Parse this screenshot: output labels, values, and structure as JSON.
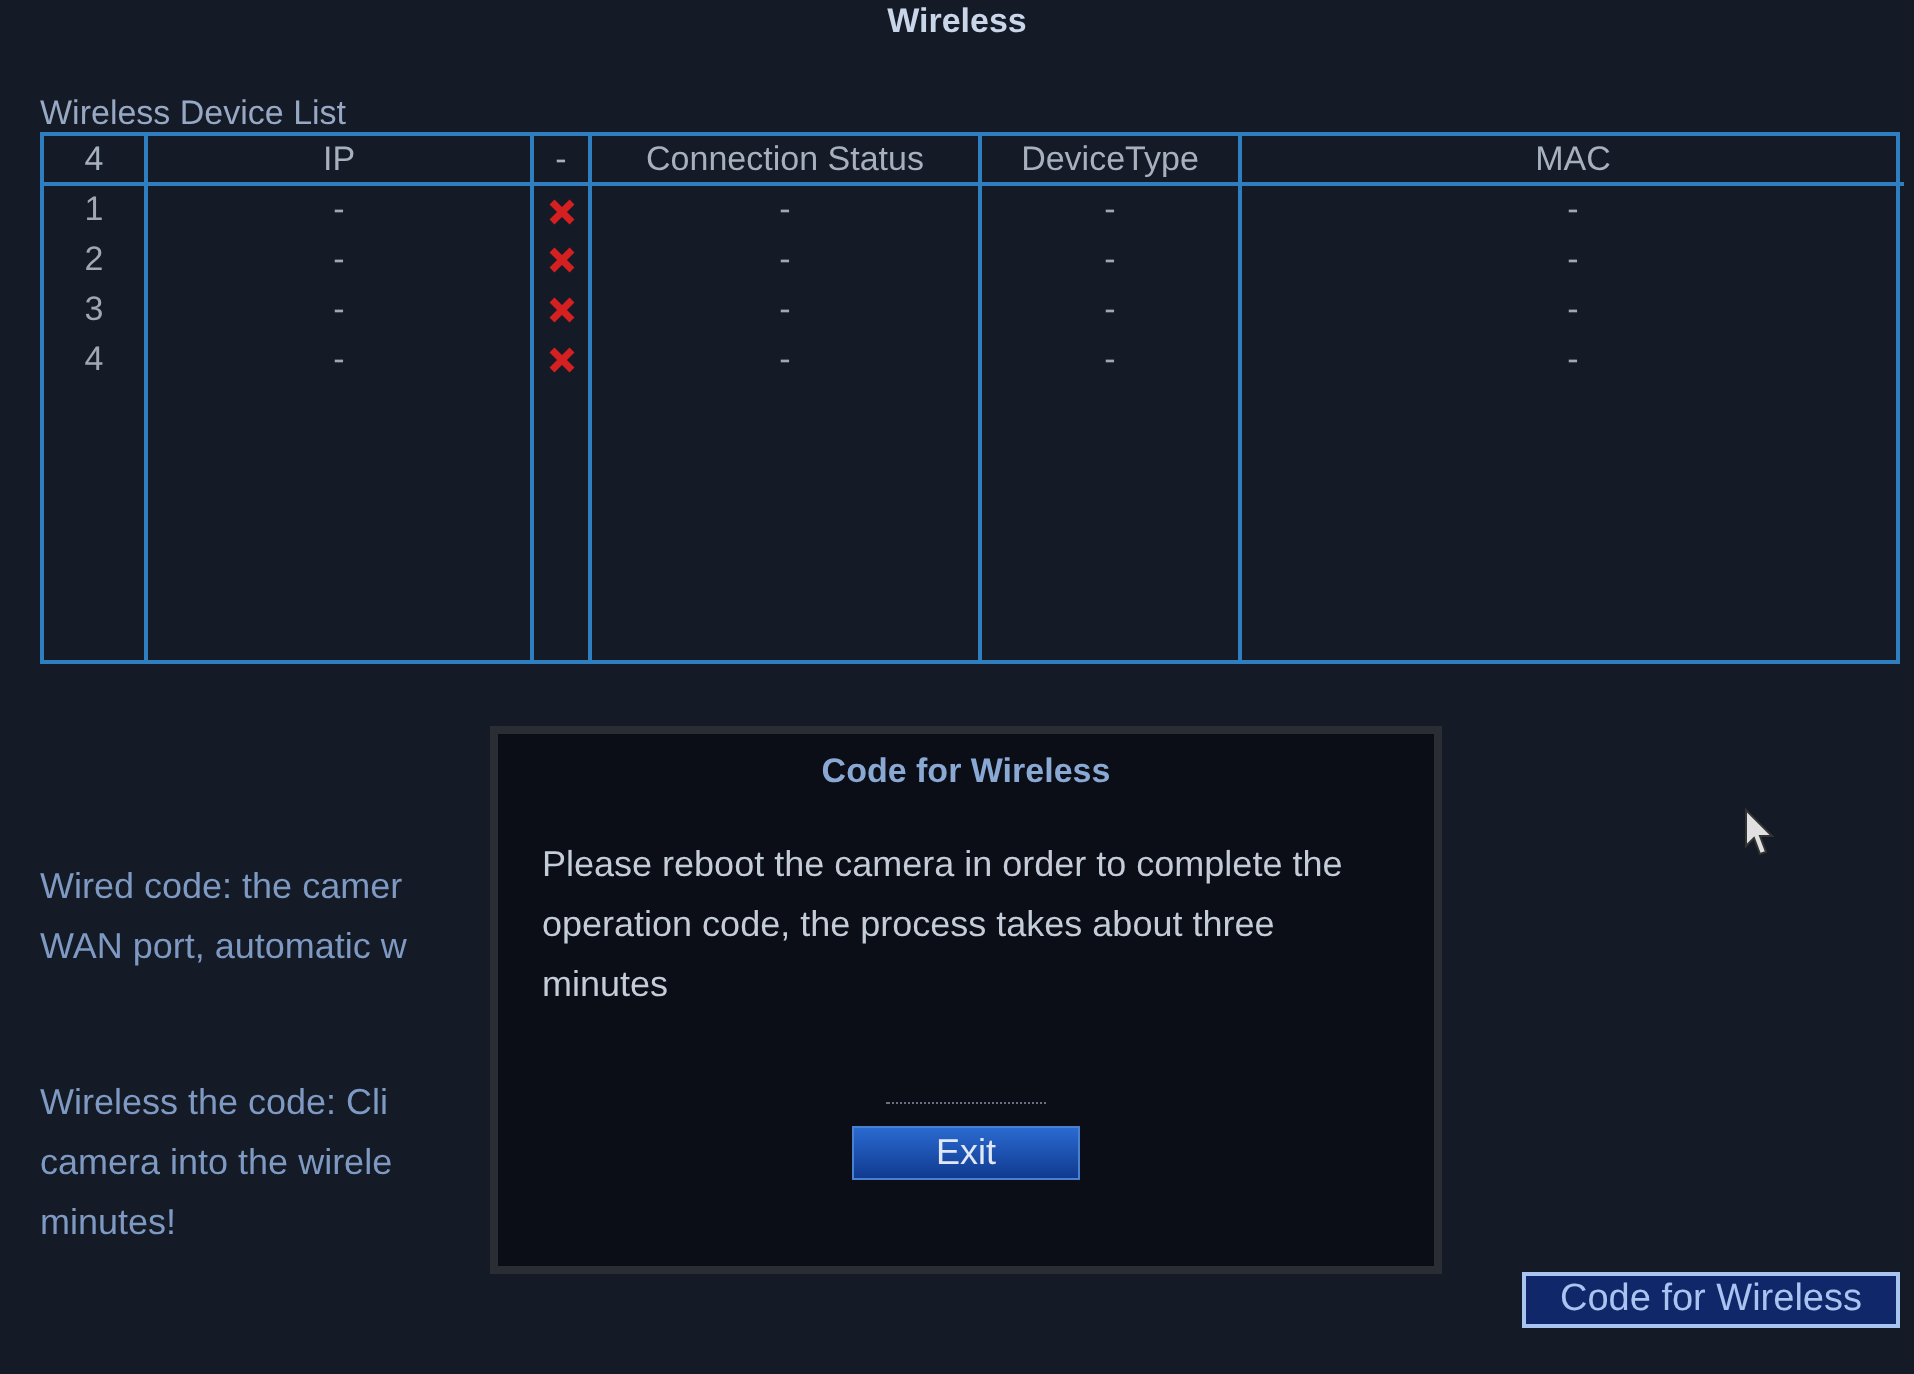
{
  "window": {
    "title": "Wireless"
  },
  "device_list": {
    "label": "Wireless Device List",
    "columns": [
      "4",
      "IP",
      "-",
      "Connection Status",
      "DeviceType",
      "MAC"
    ],
    "rows": [
      {
        "index": "1",
        "ip": "-",
        "connected": false,
        "connection_status": "-",
        "device_type": "-",
        "mac": "-"
      },
      {
        "index": "2",
        "ip": "-",
        "connected": false,
        "connection_status": "-",
        "device_type": "-",
        "mac": "-"
      },
      {
        "index": "3",
        "ip": "-",
        "connected": false,
        "connection_status": "-",
        "device_type": "-",
        "mac": "-"
      },
      {
        "index": "4",
        "ip": "-",
        "connected": false,
        "connection_status": "-",
        "device_type": "-",
        "mac": "-"
      }
    ]
  },
  "help_paragraphs": [
    [
      "Wired code: the camer",
      "WAN port, automatic w"
    ],
    [
      "Wireless the code: Cli",
      "camera into the wirele",
      "minutes!"
    ]
  ],
  "code_button": "Code for Wireless",
  "dialog": {
    "title": "Code for Wireless",
    "message": "Please reboot the camera in order to complete the operation code, the process takes about three minutes",
    "button": "Exit"
  }
}
